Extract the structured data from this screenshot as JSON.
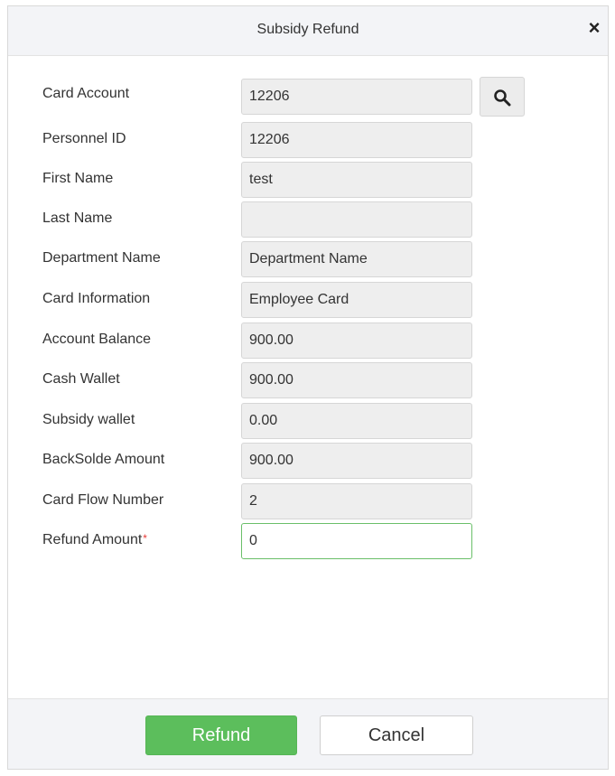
{
  "dialog": {
    "title": "Subsidy Refund",
    "close_symbol": "×"
  },
  "fields": [
    {
      "label": "Card Account",
      "value": "12206"
    },
    {
      "label": "Personnel ID",
      "value": "12206"
    },
    {
      "label": "First Name",
      "value": "test"
    },
    {
      "label": "Last Name",
      "value": ""
    },
    {
      "label": "Department Name",
      "value": "Department Name"
    },
    {
      "label": "Card Information",
      "value": "Employee Card"
    },
    {
      "label": "Account Balance",
      "value": "900.00"
    },
    {
      "label": "Cash Wallet",
      "value": "900.00"
    },
    {
      "label": "Subsidy wallet",
      "value": "0.00"
    },
    {
      "label": "BackSolde Amount",
      "value": "900.00"
    },
    {
      "label": "Card Flow Number",
      "value": "2"
    },
    {
      "label": "Refund Amount",
      "value": "0",
      "required_mark": "*"
    }
  ],
  "buttons": {
    "refund_label": "Refund",
    "cancel_label": "Cancel"
  },
  "icons": {
    "search": "search-icon",
    "close": "close-icon"
  },
  "colors": {
    "primary_green": "#5cbe5c",
    "required_red": "#e53935",
    "header_bg": "#f3f4f7",
    "readonly_bg": "#eeeeee"
  }
}
